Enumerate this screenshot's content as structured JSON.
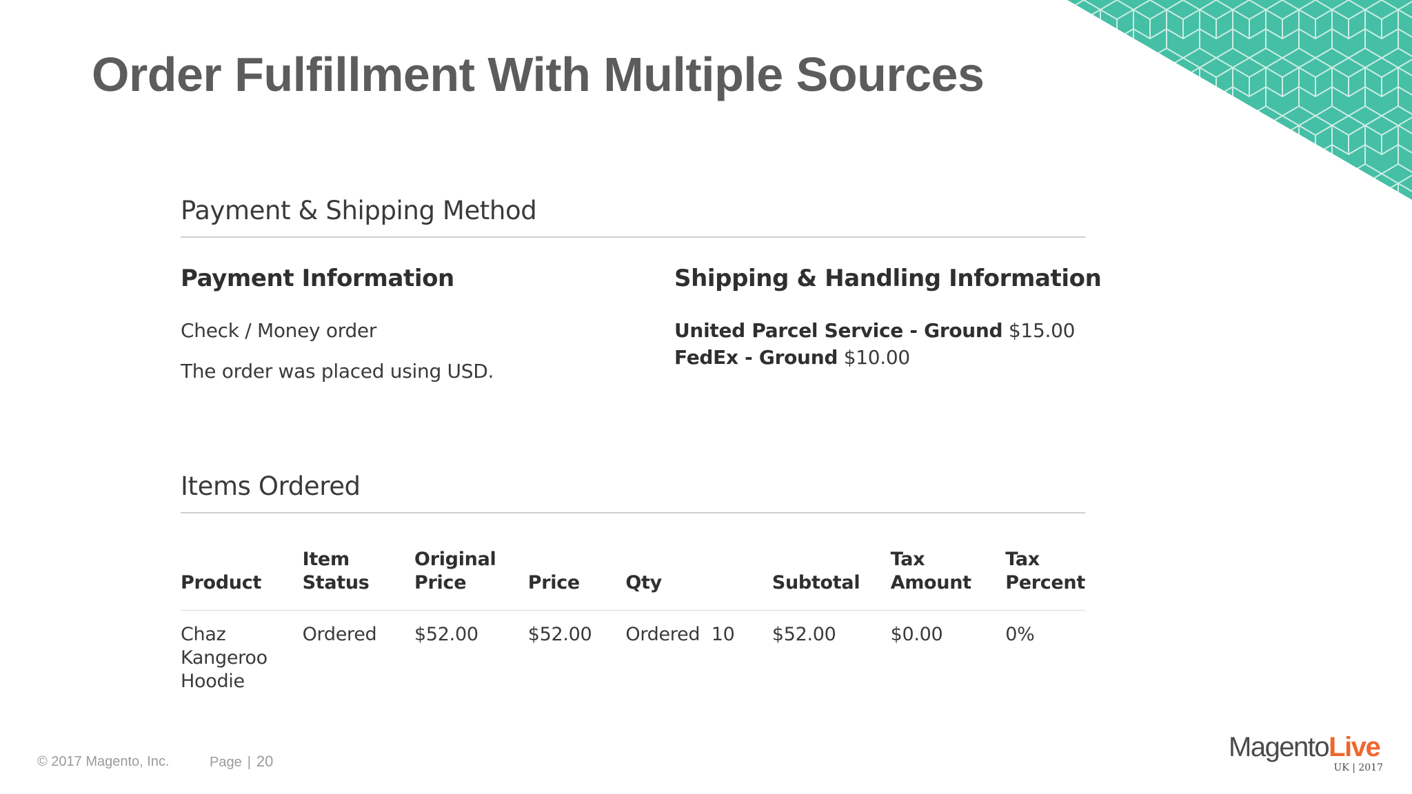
{
  "slide": {
    "title": "Order Fulfillment With Multiple Sources"
  },
  "payment_shipping": {
    "section_title": "Payment & Shipping Method",
    "payment": {
      "heading": "Payment Information",
      "method": "Check / Money order",
      "note": "The order was placed using USD."
    },
    "shipping": {
      "heading": "Shipping & Handling Information",
      "methods": [
        {
          "name": "United Parcel Service - Ground",
          "price": "$15.00"
        },
        {
          "name": "FedEx - Ground",
          "price": "$10.00"
        }
      ]
    }
  },
  "items": {
    "section_title": "Items Ordered",
    "columns": [
      "Product",
      "Item Status",
      "Original Price",
      "Price",
      "Qty",
      "Subtotal",
      "Tax Amount",
      "Tax Percent"
    ],
    "rows": [
      {
        "product": "Chaz Kangeroo Hoodie",
        "item_status": "Ordered",
        "original_price": "$52.00",
        "price": "$52.00",
        "qty": "Ordered  10",
        "subtotal": "$52.00",
        "tax_amount": "$0.00",
        "tax_percent": "0%"
      }
    ]
  },
  "footer": {
    "copyright": "© 2017 Magento, Inc.",
    "page_label": "Page",
    "separator": "|",
    "page_number": "20"
  },
  "logo": {
    "word1": "Magento",
    "word2": "Live",
    "subtitle": "UK | 2017"
  },
  "colors": {
    "accent_teal": "#45bfa5",
    "logo_orange": "#ee672d",
    "title_gray": "#5c5c5c"
  }
}
